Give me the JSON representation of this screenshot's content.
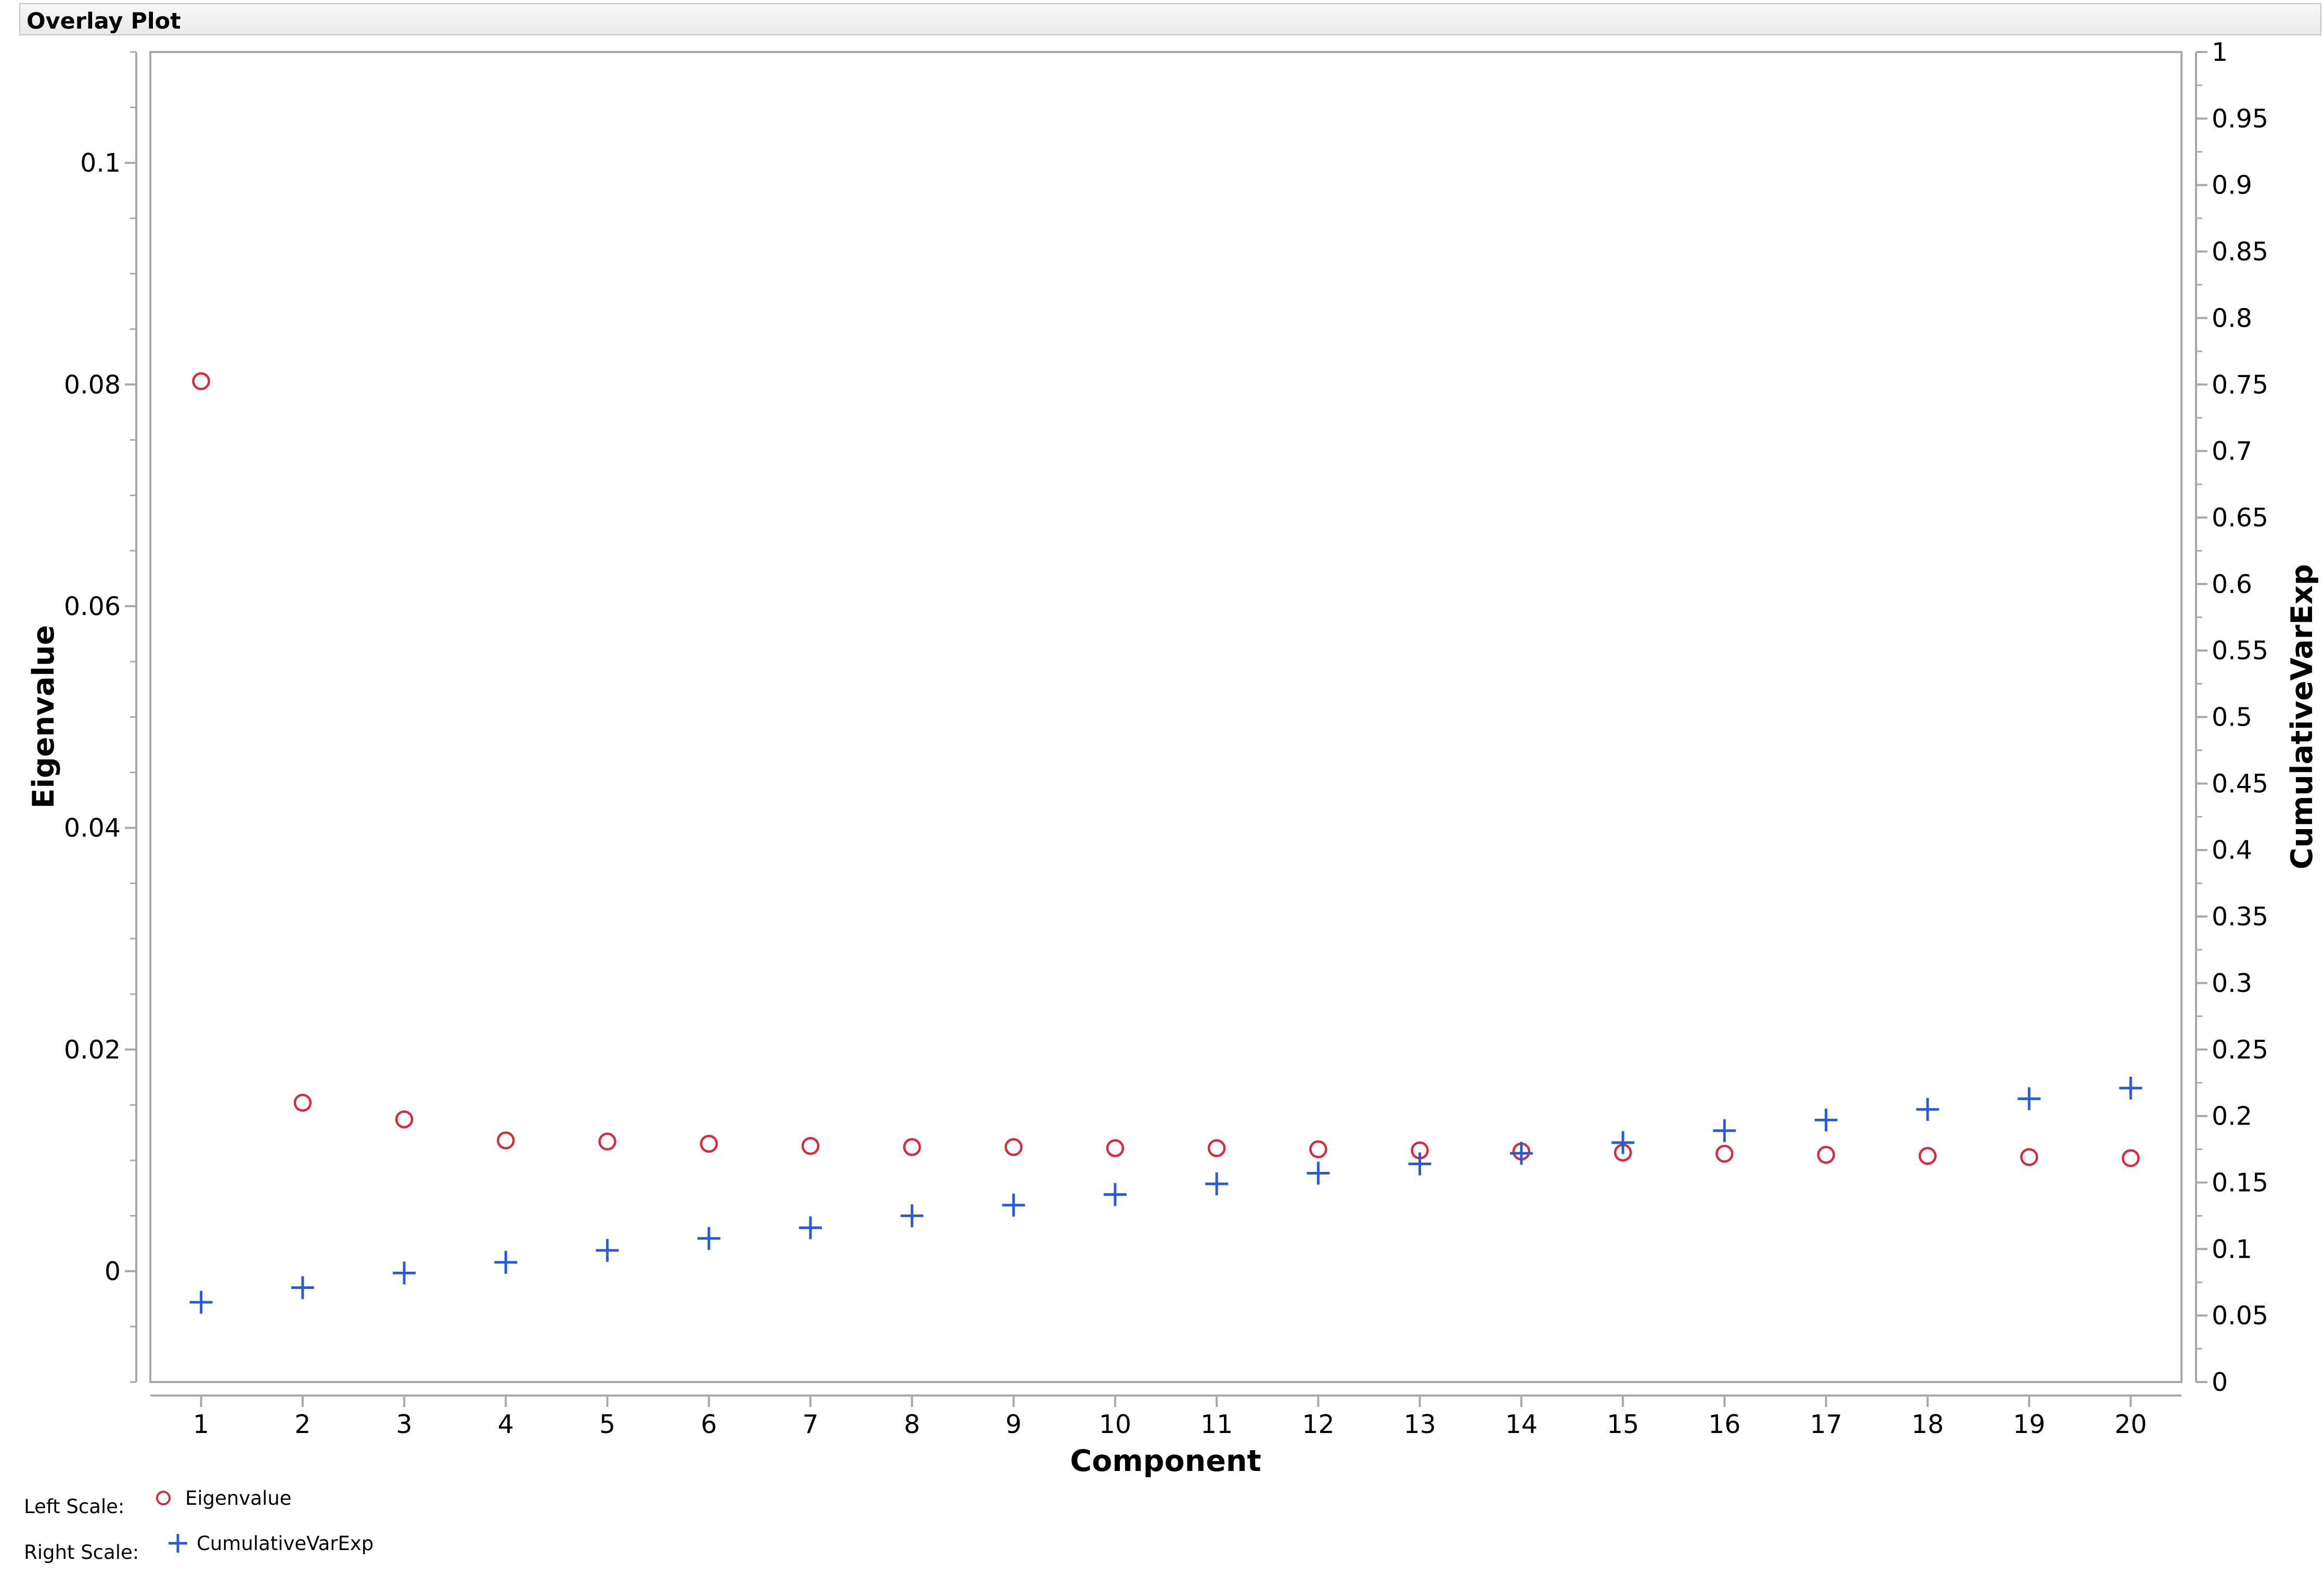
{
  "window": {
    "title": "Overlay Plot"
  },
  "legend": {
    "left_scale_label": "Left Scale:",
    "right_scale_label": "Right Scale:",
    "left_series": "Eigenvalue",
    "right_series": "CumulativeVarExp"
  },
  "colors": {
    "eigenvalue": "#d62b3c",
    "cumulative": "#2a5bd7",
    "frame": "#a9a9a9"
  },
  "chart_data": {
    "type": "scatter",
    "xlabel": "Component",
    "ylabel_left": "Eigenvalue",
    "ylabel_right": "CumulativeVarExp",
    "x": [
      1,
      2,
      3,
      4,
      5,
      6,
      7,
      8,
      9,
      10,
      11,
      12,
      13,
      14,
      15,
      16,
      17,
      18,
      19,
      20
    ],
    "xlim": [
      0.5,
      20.5
    ],
    "ylim_left": [
      -0.01,
      0.11
    ],
    "ylim_right": [
      0,
      1
    ],
    "y_ticks_left": [
      "0",
      "0.02",
      "0.04",
      "0.06",
      "0.08",
      "0.1"
    ],
    "y_ticks_right": [
      "0",
      "0.05",
      "0.1",
      "0.15",
      "0.2",
      "0.25",
      "0.3",
      "0.35",
      "0.4",
      "0.45",
      "0.5",
      "0.55",
      "0.6",
      "0.65",
      "0.7",
      "0.75",
      "0.8",
      "0.85",
      "0.9",
      "0.95",
      "1"
    ],
    "grid": false,
    "series": [
      {
        "name": "Eigenvalue",
        "axis": "left",
        "marker": "circle",
        "values": [
          0.0803,
          0.0152,
          0.0137,
          0.0118,
          0.0117,
          0.0115,
          0.0113,
          0.0112,
          0.0112,
          0.0111,
          0.0111,
          0.011,
          0.0109,
          0.0108,
          0.0107,
          0.0106,
          0.0105,
          0.0104,
          0.0103,
          0.0102
        ]
      },
      {
        "name": "CumulativeVarExp",
        "axis": "right",
        "marker": "plus",
        "values": [
          0.06,
          0.071,
          0.082,
          0.09,
          0.099,
          0.108,
          0.116,
          0.125,
          0.133,
          0.141,
          0.149,
          0.157,
          0.164,
          0.172,
          0.18,
          0.189,
          0.197,
          0.205,
          0.213,
          0.221
        ]
      }
    ]
  }
}
